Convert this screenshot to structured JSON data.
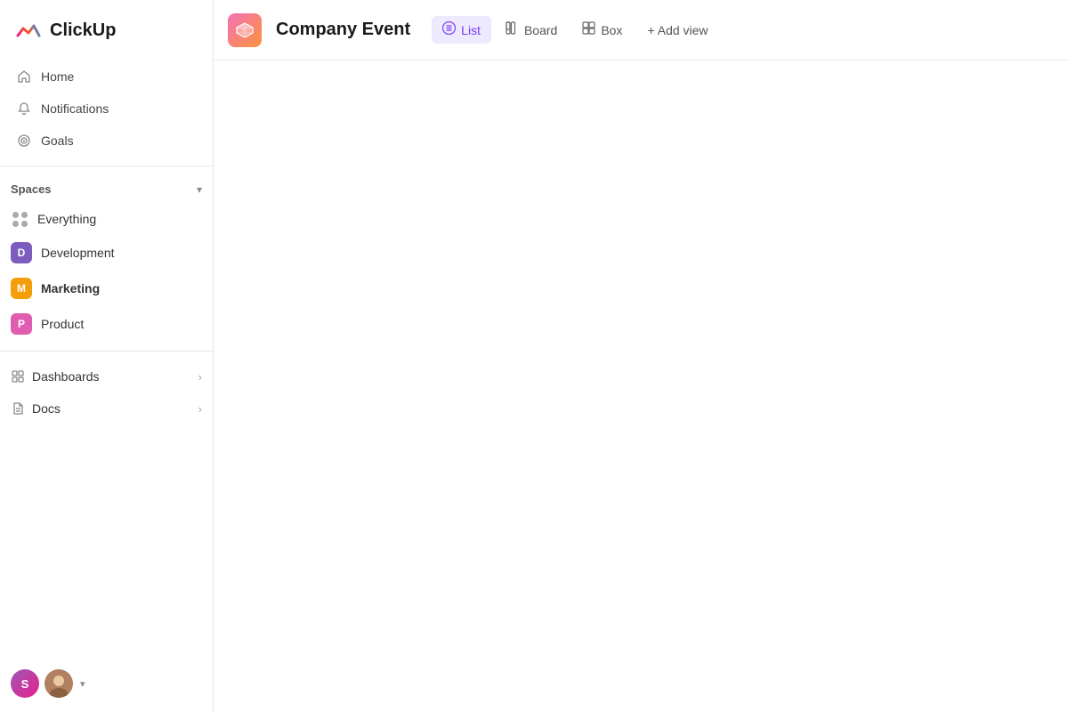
{
  "sidebar": {
    "logo_text": "ClickUp",
    "nav": {
      "home_label": "Home",
      "notifications_label": "Notifications",
      "goals_label": "Goals"
    },
    "spaces_section": {
      "title": "Spaces",
      "chevron": "▾",
      "items": [
        {
          "id": "everything",
          "label": "Everything",
          "type": "dots"
        },
        {
          "id": "development",
          "label": "Development",
          "badge": "D",
          "badge_class": "badge-d"
        },
        {
          "id": "marketing",
          "label": "Marketing",
          "badge": "M",
          "badge_class": "badge-m",
          "bold": true
        },
        {
          "id": "product",
          "label": "Product",
          "badge": "P",
          "badge_class": "badge-p"
        }
      ]
    },
    "collapsibles": [
      {
        "id": "dashboards",
        "label": "Dashboards"
      },
      {
        "id": "docs",
        "label": "Docs"
      }
    ],
    "bottom": {
      "avatar_initial": "S",
      "chevron": "▾"
    }
  },
  "topbar": {
    "project_title": "Company Event",
    "tabs": [
      {
        "id": "list",
        "label": "List",
        "active": true,
        "icon": "≡"
      },
      {
        "id": "board",
        "label": "Board",
        "active": false,
        "icon": "⊞"
      },
      {
        "id": "box",
        "label": "Box",
        "active": false,
        "icon": "⊟"
      }
    ],
    "add_view_label": "+ Add view"
  },
  "icons": {
    "home": "⌂",
    "bell": "🔔",
    "goal": "◎",
    "chevron_right": "›",
    "chevron_down": "⌄",
    "list_icon": "☰",
    "board_icon": "▦",
    "box_icon": "▣",
    "cube": "⬡"
  }
}
